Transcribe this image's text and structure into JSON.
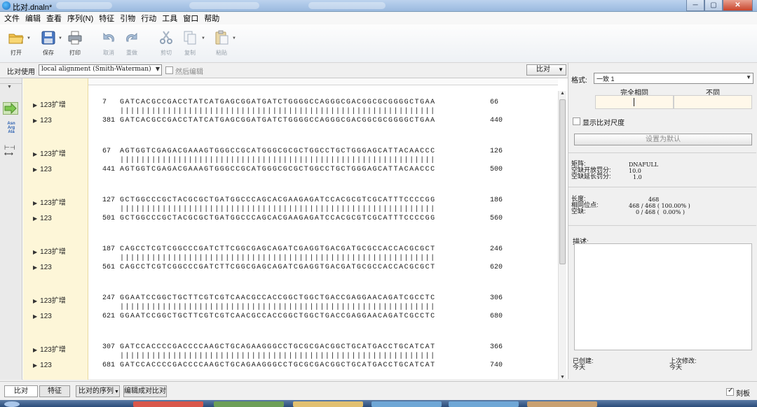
{
  "window": {
    "title": "比对.dnaln*"
  },
  "menu": [
    "文件",
    "编辑",
    "查看",
    "序列(N)",
    "特征",
    "引物",
    "行动",
    "工具",
    "窗口",
    "帮助"
  ],
  "toolbar": {
    "open": "打开",
    "save": "保存",
    "print": "打印",
    "undo": "取消",
    "redo": "重做",
    "cut": "剪切",
    "copy": "复制",
    "paste": "粘贴"
  },
  "align_options": {
    "label": "比对使用",
    "method": "local alignment  (Smith-Waterman)",
    "post_edit_label": "然后编辑",
    "post_edit_checked": false,
    "compare_button": "比对"
  },
  "alignment": {
    "blocks": [
      {
        "name1": "123扩增",
        "name2": "123",
        "start1": "7",
        "end1": "66",
        "start2": "381",
        "end2": "440",
        "seq1": "GATCACGCCGACCTATCATGAGCGGATGATCTGGGGCCAGGGCGACGGCGCGGGGCTGAA",
        "seq2": "GATCACGCCGACCTATCATGAGCGGATGATCTGGGGCCAGGGCGACGGCGCGGGGCTGAA"
      },
      {
        "name1": "123扩增",
        "name2": "123",
        "start1": "67",
        "end1": "126",
        "start2": "441",
        "end2": "500",
        "seq1": "AGTGGTCGAGACGAAAGTGGGCCGCATGGGCGCGCTGGCCTGCTGGGAGCATTACAACCC",
        "seq2": "AGTGGTCGAGACGAAAGTGGGCCGCATGGGCGCGCTGGCCTGCTGGGAGCATTACAACCC"
      },
      {
        "name1": "123扩增",
        "name2": "123",
        "start1": "127",
        "end1": "186",
        "start2": "501",
        "end2": "560",
        "seq1": "GCTGGCCCGCTACGCGCTGATGGCCCAGCACGAAGAGATCCACGCGTCGCATTTCCCCGG",
        "seq2": "GCTGGCCCGCTACGCGCTGATGGCCCAGCACGAAGAGATCCACGCGTCGCATTTCCCCGG"
      },
      {
        "name1": "123扩增",
        "name2": "123",
        "start1": "187",
        "end1": "246",
        "start2": "561",
        "end2": "620",
        "seq1": "CAGCCTCGTCGGCCCGATCTTCGGCGAGCAGATCGAGGTGACGATGCGCCACCACGCGCT",
        "seq2": "CAGCCTCGTCGGCCCGATCTTCGGCGAGCAGATCGAGGTGACGATGCGCCACCACGCGCT"
      },
      {
        "name1": "123扩增",
        "name2": "123",
        "start1": "247",
        "end1": "306",
        "start2": "621",
        "end2": "680",
        "seq1": "GGAATCCGGCTGCTTCGTCGTCAACGCCACCGGCTGGCTGACCGAGGAACAGATCGCCTC",
        "seq2": "GGAATCCGGCTGCTTCGTCGTCAACGCCACCGGCTGGCTGACCGAGGAACAGATCGCCTC"
      },
      {
        "name1": "123扩增",
        "name2": "123",
        "start1": "307",
        "end1": "366",
        "start2": "681",
        "end2": "740",
        "seq1": "GATCCACCCCGACCCCAAGCTGCAGAAGGGCCTGCGCGACGGCTGCATGACCTGCATCAT",
        "seq2": "GATCCACCCCGACCCCAAGCTGCAGAAGGGCCTGCGCGACGGCTGCATGACCTGCATCAT"
      }
    ],
    "match_line": "||||||||||||||||||||||||||||||||||||||||||||||||||||||||||||"
  },
  "panel": {
    "format_label": "格式:",
    "format_value": "一致 1",
    "col_same": "完全相同",
    "col_diff": "不同",
    "show_scale_label": "显示比对尺度",
    "show_scale_checked": false,
    "default_button": "设置为默认",
    "matrix_label": "矩阵:",
    "matrix_value": "DNAFULL",
    "gap_open_label": "空缺开放罚分:",
    "gap_open_value": "10.0",
    "gap_ext_label": "空缺延长罚分:",
    "gap_ext_value": "1.0",
    "length_label": "长度:",
    "length_value": "468",
    "identity_label": "相同位点:",
    "identity_value": "468 / 468 ( 100.00% )",
    "gaps_label": "空缺:",
    "gaps_value": "0 / 468 (  0.00% )",
    "desc_label": "描述:",
    "created_label": "已创建:",
    "created_value": "今天",
    "modified_label": "上次修改:",
    "modified_value": "今天"
  },
  "bottom": {
    "tab_align": "比对",
    "tab_feature": "特征",
    "seq_menu": "比对的序列",
    "edit_btn": "编辑成对比对",
    "ruler_label": "刻板",
    "ruler_checked": true
  }
}
